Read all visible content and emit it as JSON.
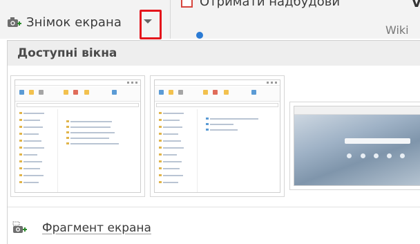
{
  "ribbon": {
    "screenshot_label": "Знімок екрана",
    "get_addins_label": "Отримати надбудови",
    "right_partial_label": "V",
    "wiki_partial_label": "Wiki"
  },
  "dropdown": {
    "header_title": "Доступні вікна",
    "fragment_label": "Фрагмент екрана",
    "windows": [
      {
        "name": "explorer-window-1"
      },
      {
        "name": "explorer-window-2"
      },
      {
        "name": "browser-window"
      }
    ]
  },
  "colors": {
    "highlight_border": "#e4141b",
    "ribbon_bg": "#f3f3f3",
    "header_bg": "#eeeeee",
    "text": "#3b3b3b"
  },
  "icons": {
    "screenshot": "camera-plus-icon",
    "dropdown": "chevron-down-icon",
    "addins": "store-icon",
    "fragment": "camera-plus-icon"
  }
}
